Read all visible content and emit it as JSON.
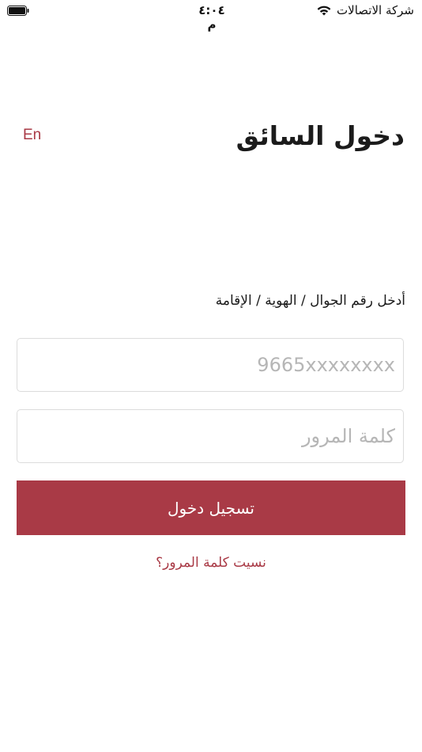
{
  "status_bar": {
    "carrier": "شركة الاتصالات",
    "time": "٤:٠٤ م",
    "wifi_icon": "wifi-icon",
    "battery_icon": "battery-icon"
  },
  "header": {
    "language_toggle": "En",
    "title": "دخول السائق"
  },
  "form": {
    "id_label": "أدخل رقم الجوال / الهوية / الإقامة",
    "phone_placeholder": "9665xxxxxxxx",
    "password_placeholder": "كلمة المرور",
    "login_label": "تسجيل دخول",
    "forgot_password": "نسيت كلمة المرور؟"
  },
  "colors": {
    "accent": "#a93a46",
    "input_border": "#dcdcdc",
    "placeholder": "#b6b6b6"
  }
}
